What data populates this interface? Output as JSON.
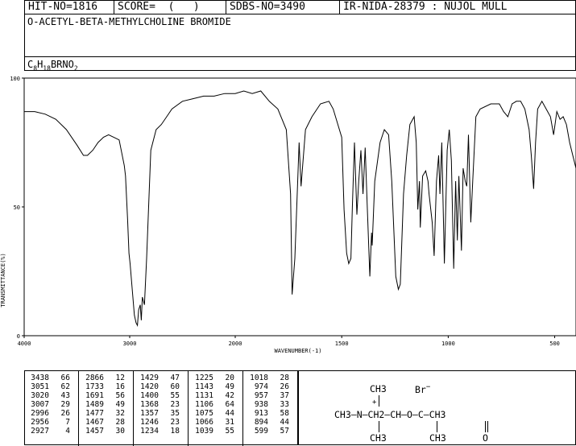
{
  "header": {
    "hit": "HIT-NO=1816",
    "score": "SCORE=  (   )",
    "sdbs": "SDBS-NO=3490",
    "ir": "IR-NIDA-28379 : NUJOL MULL"
  },
  "compound_name": "O-ACETYL-BETA-METHYLCHOLINE BROMIDE",
  "formula": {
    "c": "C",
    "c_n": "8",
    "h": "H",
    "h_n": "18",
    "rest": "BRNO",
    "o_n": "2"
  },
  "chart_data": {
    "type": "line",
    "xlabel": "WAVENUMBER(-1)",
    "ylabel": "TRANSMITTANCE(%)",
    "xlim": [
      4000,
      400
    ],
    "ylim": [
      0,
      100
    ],
    "x_ticks": [
      4000,
      3000,
      2000,
      1500,
      1000,
      500
    ],
    "x_tick_labels": [
      "4000",
      "3000",
      "2000",
      "1500",
      "1000",
      "500"
    ],
    "y_ticks": [
      0,
      50,
      100
    ],
    "y_tick_labels": [
      "0",
      "50",
      "100"
    ],
    "spectrum": [
      [
        4000,
        87
      ],
      [
        3900,
        87
      ],
      [
        3800,
        86
      ],
      [
        3700,
        84
      ],
      [
        3600,
        80
      ],
      [
        3500,
        74
      ],
      [
        3438,
        70
      ],
      [
        3400,
        70
      ],
      [
        3350,
        72
      ],
      [
        3300,
        75
      ],
      [
        3250,
        77
      ],
      [
        3200,
        78
      ],
      [
        3150,
        77
      ],
      [
        3100,
        76
      ],
      [
        3051,
        66
      ],
      [
        3040,
        62
      ],
      [
        3020,
        45
      ],
      [
        3007,
        32
      ],
      [
        2996,
        28
      ],
      [
        2980,
        20
      ],
      [
        2956,
        8
      ],
      [
        2940,
        5
      ],
      [
        2927,
        4
      ],
      [
        2915,
        10
      ],
      [
        2900,
        12
      ],
      [
        2890,
        6
      ],
      [
        2880,
        15
      ],
      [
        2860,
        12
      ],
      [
        2840,
        30
      ],
      [
        2800,
        72
      ],
      [
        2750,
        80
      ],
      [
        2700,
        82
      ],
      [
        2650,
        85
      ],
      [
        2600,
        88
      ],
      [
        2500,
        91
      ],
      [
        2400,
        92
      ],
      [
        2300,
        93
      ],
      [
        2200,
        93
      ],
      [
        2100,
        94
      ],
      [
        2000,
        94
      ],
      [
        1960,
        95
      ],
      [
        1920,
        94
      ],
      [
        1880,
        95
      ],
      [
        1840,
        91
      ],
      [
        1800,
        88
      ],
      [
        1760,
        80
      ],
      [
        1740,
        55
      ],
      [
        1733,
        16
      ],
      [
        1720,
        30
      ],
      [
        1700,
        75
      ],
      [
        1691,
        58
      ],
      [
        1670,
        80
      ],
      [
        1640,
        85
      ],
      [
        1600,
        90
      ],
      [
        1560,
        91
      ],
      [
        1540,
        88
      ],
      [
        1500,
        77
      ],
      [
        1489,
        49
      ],
      [
        1477,
        32
      ],
      [
        1467,
        28
      ],
      [
        1457,
        30
      ],
      [
        1450,
        50
      ],
      [
        1440,
        75
      ],
      [
        1429,
        47
      ],
      [
        1420,
        60
      ],
      [
        1410,
        72
      ],
      [
        1400,
        55
      ],
      [
        1390,
        73
      ],
      [
        1380,
        50
      ],
      [
        1368,
        23
      ],
      [
        1360,
        40
      ],
      [
        1357,
        35
      ],
      [
        1345,
        60
      ],
      [
        1320,
        75
      ],
      [
        1300,
        80
      ],
      [
        1280,
        78
      ],
      [
        1265,
        60
      ],
      [
        1246,
        23
      ],
      [
        1234,
        18
      ],
      [
        1225,
        20
      ],
      [
        1210,
        55
      ],
      [
        1195,
        70
      ],
      [
        1180,
        82
      ],
      [
        1160,
        85
      ],
      [
        1150,
        75
      ],
      [
        1143,
        49
      ],
      [
        1135,
        60
      ],
      [
        1131,
        42
      ],
      [
        1120,
        62
      ],
      [
        1106,
        64
      ],
      [
        1095,
        60
      ],
      [
        1090,
        55
      ],
      [
        1075,
        44
      ],
      [
        1066,
        31
      ],
      [
        1055,
        60
      ],
      [
        1045,
        70
      ],
      [
        1039,
        55
      ],
      [
        1030,
        75
      ],
      [
        1018,
        28
      ],
      [
        1005,
        72
      ],
      [
        995,
        80
      ],
      [
        985,
        68
      ],
      [
        974,
        26
      ],
      [
        965,
        60
      ],
      [
        957,
        37
      ],
      [
        950,
        62
      ],
      [
        938,
        33
      ],
      [
        930,
        65
      ],
      [
        920,
        60
      ],
      [
        913,
        58
      ],
      [
        905,
        78
      ],
      [
        894,
        44
      ],
      [
        885,
        60
      ],
      [
        870,
        85
      ],
      [
        850,
        88
      ],
      [
        800,
        90
      ],
      [
        760,
        90
      ],
      [
        740,
        87
      ],
      [
        720,
        85
      ],
      [
        700,
        90
      ],
      [
        680,
        91
      ],
      [
        660,
        91
      ],
      [
        640,
        88
      ],
      [
        620,
        80
      ],
      [
        610,
        70
      ],
      [
        599,
        57
      ],
      [
        590,
        75
      ],
      [
        580,
        88
      ],
      [
        560,
        91
      ],
      [
        540,
        88
      ],
      [
        520,
        85
      ],
      [
        505,
        78
      ],
      [
        490,
        87
      ],
      [
        475,
        84
      ],
      [
        460,
        85
      ],
      [
        445,
        82
      ],
      [
        430,
        75
      ],
      [
        415,
        70
      ],
      [
        400,
        65
      ]
    ]
  },
  "peak_table": [
    [
      [
        "3438",
        "66"
      ],
      [
        "3051",
        "62"
      ],
      [
        "3020",
        "43"
      ],
      [
        "3007",
        "29"
      ],
      [
        "2996",
        "26"
      ],
      [
        "2956",
        "7"
      ],
      [
        "2927",
        "4"
      ]
    ],
    [
      [
        "2866",
        "12"
      ],
      [
        "1733",
        "16"
      ],
      [
        "1691",
        "56"
      ],
      [
        "1489",
        "49"
      ],
      [
        "1477",
        "32"
      ],
      [
        "1467",
        "28"
      ],
      [
        "1457",
        "30"
      ]
    ],
    [
      [
        "1429",
        "47"
      ],
      [
        "1420",
        "60"
      ],
      [
        "1400",
        "55"
      ],
      [
        "1368",
        "23"
      ],
      [
        "1357",
        "35"
      ],
      [
        "1246",
        "23"
      ],
      [
        "1234",
        "18"
      ]
    ],
    [
      [
        "1225",
        "20"
      ],
      [
        "1143",
        "49"
      ],
      [
        "1131",
        "42"
      ],
      [
        "1106",
        "64"
      ],
      [
        "1075",
        "44"
      ],
      [
        "1066",
        "31"
      ],
      [
        "1039",
        "55"
      ]
    ],
    [
      [
        "1018",
        "28"
      ],
      [
        "974",
        "26"
      ],
      [
        "957",
        "37"
      ],
      [
        "938",
        "33"
      ],
      [
        "913",
        "58"
      ],
      [
        "894",
        "44"
      ],
      [
        "599",
        "57"
      ]
    ]
  ],
  "structure": {
    "ch3_top": "CH3",
    "br": "Br",
    "br_charge": "−",
    "plus": "+",
    "main_chain": "CH3—N—CH2—CH—O—C—CH3",
    "ch3_bottom_left": "CH3",
    "ch3_bottom_mid": "CH3",
    "carbonyl_o": "O"
  }
}
